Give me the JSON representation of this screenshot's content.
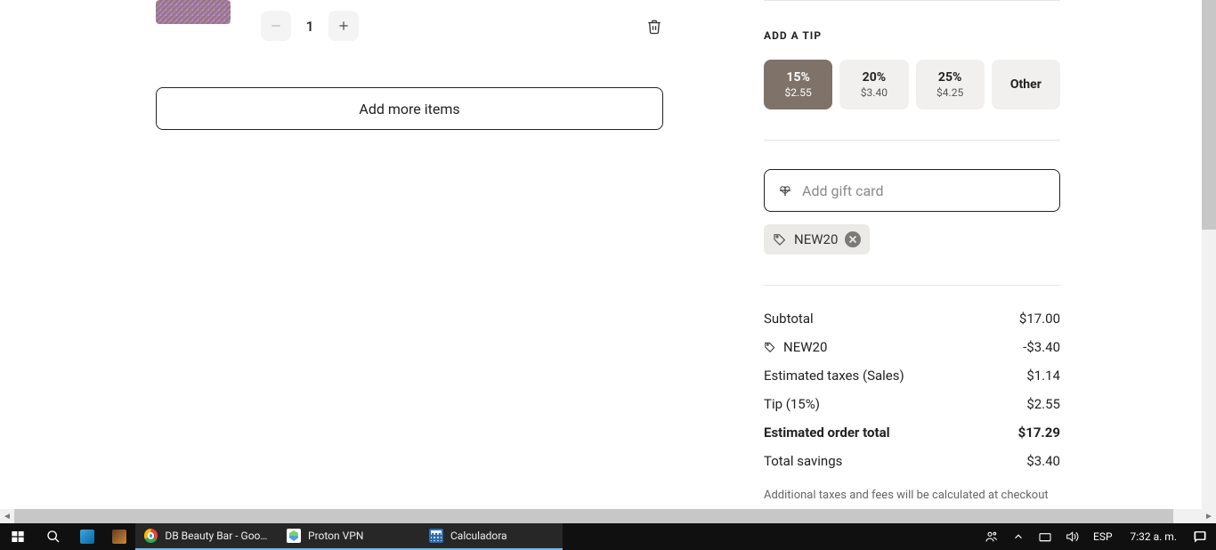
{
  "cart": {
    "quantity": "1",
    "add_more_label": "Add more items"
  },
  "tip": {
    "section_label": "ADD A TIP",
    "options": [
      {
        "pct": "15%",
        "amt": "$2.55"
      },
      {
        "pct": "20%",
        "amt": "$3.40"
      },
      {
        "pct": "25%",
        "amt": "$4.25"
      }
    ],
    "other_label": "Other"
  },
  "gift": {
    "placeholder": "Add gift card"
  },
  "promo": {
    "code": "NEW20"
  },
  "summary": {
    "rows": {
      "subtotal_label": "Subtotal",
      "subtotal_value": "$17.00",
      "promo_label": "NEW20",
      "promo_value": "-$3.40",
      "tax_label": "Estimated taxes (Sales)",
      "tax_value": "$1.14",
      "tip_label": "Tip (15%)",
      "tip_value": "$2.55",
      "total_label": "Estimated order total",
      "total_value": "$17.29",
      "savings_label": "Total savings",
      "savings_value": "$3.40"
    },
    "disclaimer": "Additional taxes and fees will be calculated at checkout"
  },
  "taskbar": {
    "apps": {
      "chrome": "DB Beauty Bar - Goog…",
      "vpn": "Proton VPN",
      "calc": "Calculadora"
    },
    "lang": "ESP",
    "time": "7:32 a. m."
  }
}
